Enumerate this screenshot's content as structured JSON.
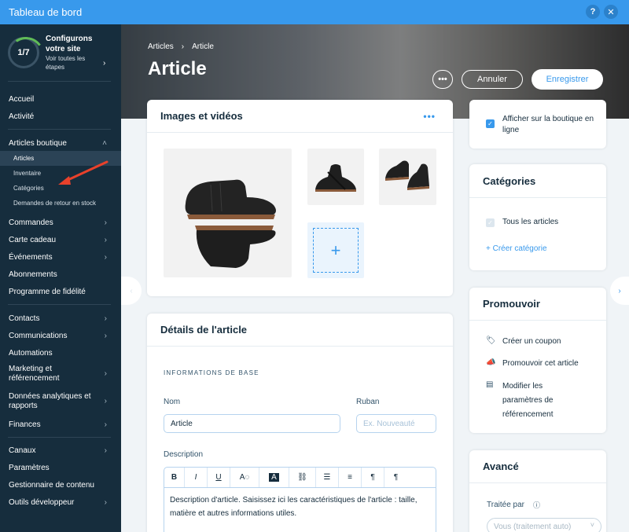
{
  "window": {
    "title": "Tableau de bord",
    "help_label": "?",
    "close_label": "✕"
  },
  "sidebar": {
    "onboarding": {
      "progress": "1/7",
      "progress_fraction": 0.14,
      "title": "Configurons votre site",
      "subtitle": "Voir toutes les étapes"
    },
    "items": [
      {
        "label": "Accueil"
      },
      {
        "label": "Activité"
      },
      {
        "label": "Articles boutique"
      },
      {
        "label": "Commandes"
      },
      {
        "label": "Carte cadeau"
      },
      {
        "label": "Événements"
      },
      {
        "label": "Abonnements"
      },
      {
        "label": "Programme de fidélité"
      },
      {
        "label": "Contacts"
      },
      {
        "label": "Communications"
      },
      {
        "label": "Automations"
      },
      {
        "label": "Marketing et référencement"
      },
      {
        "label": "Données analytiques et rapports"
      },
      {
        "label": "Finances"
      },
      {
        "label": "Canaux"
      },
      {
        "label": "Paramètres"
      },
      {
        "label": "Gestionnaire de contenu"
      },
      {
        "label": "Outils développeur"
      }
    ],
    "sub_items": [
      {
        "label": "Articles"
      },
      {
        "label": "Inventaire"
      },
      {
        "label": "Catégories"
      },
      {
        "label": "Demandes de retour en stock"
      }
    ]
  },
  "header": {
    "breadcrumb": [
      "Articles",
      "Article"
    ],
    "title": "Article",
    "more_label": "•••",
    "cancel_label": "Annuler",
    "save_label": "Enregistrer"
  },
  "media": {
    "title": "Images et vidéos",
    "dots": "•••",
    "add_label": "+"
  },
  "details": {
    "title": "Détails de l'article",
    "section": "INFORMATIONS DE BASE",
    "name_label": "Nom",
    "name_value": "Article",
    "ribbon_label": "Ruban",
    "ribbon_placeholder": "Ex. Nouveauté",
    "description_label": "Description",
    "description_text": "Description d'article. Saisissez ici les caractéristiques de l'article : taille, matière et autres informations utiles."
  },
  "visibility": {
    "label": "Afficher sur la boutique en ligne",
    "checked": true
  },
  "categories": {
    "title": "Catégories",
    "all_label": "Tous les articles",
    "create_label": "+ Créer catégorie"
  },
  "promote": {
    "title": "Promouvoir",
    "items": [
      {
        "label": "Créer un coupon",
        "icon": "coupon-icon"
      },
      {
        "label": "Promouvoir cet article",
        "icon": "megaphone-icon"
      },
      {
        "label": "Modifier les paramètres de référencement",
        "icon": "seo-icon"
      }
    ]
  },
  "advanced": {
    "title": "Avancé",
    "handled_by_label": "Traitée par",
    "handled_by_value": "Vous (traitement auto)"
  },
  "colors": {
    "accent": "#3899ec",
    "sidebar": "#162d3d",
    "progress": "#60bc57"
  }
}
